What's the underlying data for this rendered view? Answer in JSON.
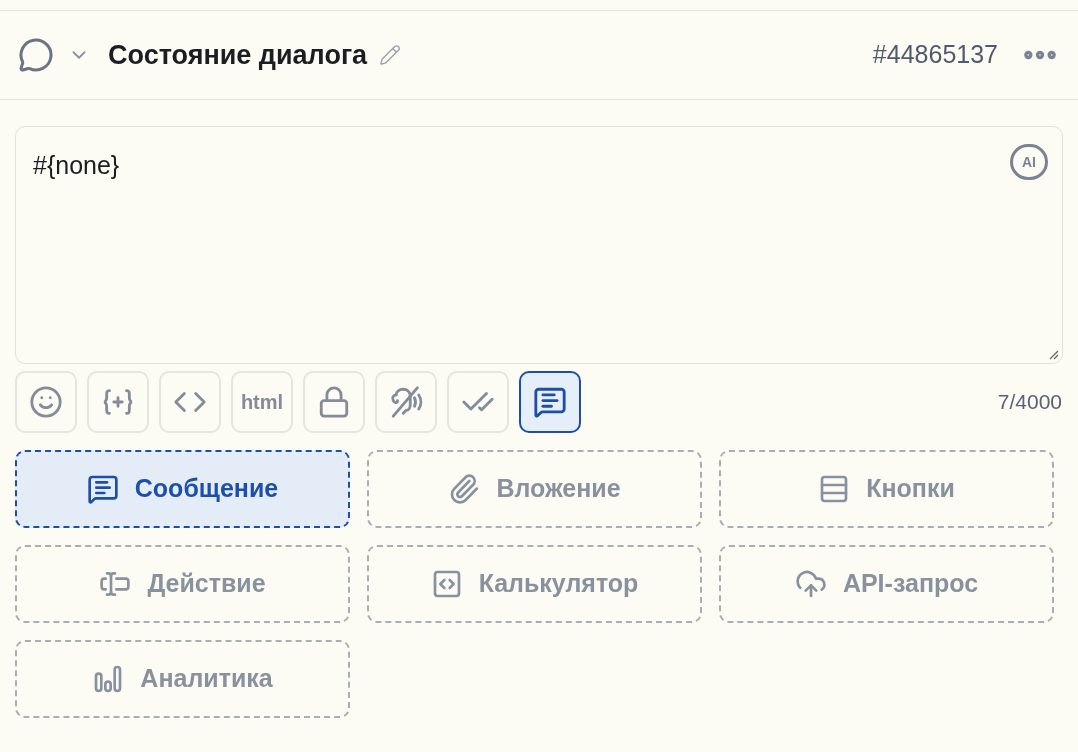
{
  "header": {
    "title": "Состояние диалога",
    "id": "#44865137"
  },
  "editor": {
    "value": "#{none}",
    "ai_label": "AI",
    "counter": "7/4000"
  },
  "toolbar": [
    {
      "kind": "emoji",
      "selected": false
    },
    {
      "kind": "variable",
      "selected": false
    },
    {
      "kind": "code",
      "selected": false
    },
    {
      "kind": "html",
      "label": "html",
      "selected": false
    },
    {
      "kind": "lock",
      "selected": false
    },
    {
      "kind": "voice-off",
      "selected": false
    },
    {
      "kind": "read",
      "selected": false
    },
    {
      "kind": "message",
      "selected": true
    }
  ],
  "blocks": [
    {
      "kind": "message",
      "label": "Сообщение",
      "selected": true
    },
    {
      "kind": "attachment",
      "label": "Вложение",
      "selected": false
    },
    {
      "kind": "buttons",
      "label": "Кнопки",
      "selected": false
    },
    {
      "kind": "action",
      "label": "Действие",
      "selected": false
    },
    {
      "kind": "calculator",
      "label": "Калькулятор",
      "selected": false
    },
    {
      "kind": "api",
      "label": "API-запрос",
      "selected": false
    },
    {
      "kind": "analytics",
      "label": "Аналитика",
      "selected": false
    }
  ]
}
